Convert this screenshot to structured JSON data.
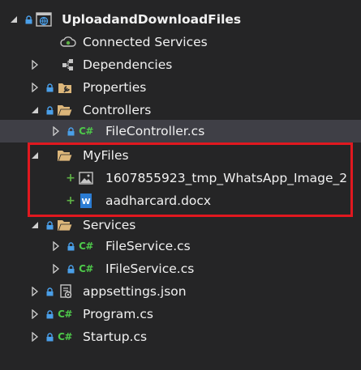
{
  "tree": {
    "project": "UploadandDownloadFiles",
    "connected_services": "Connected Services",
    "dependencies": "Dependencies",
    "properties": "Properties",
    "controllers": "Controllers",
    "file_controller": "FileController.cs",
    "myfiles": "MyFiles",
    "image_file": "1607855923_tmp_WhatsApp_Image_2",
    "docx_file": "aadharcard.docx",
    "services": "Services",
    "file_service": "FileService.cs",
    "ifile_service": "IFileService.cs",
    "appsettings": "appsettings.json",
    "program": "Program.cs",
    "startup": "Startup.cs"
  },
  "icons": {
    "cs_glyph": "C#",
    "word_glyph": "W"
  },
  "colors": {
    "background": "#252526",
    "selected_row": "#3f3f46",
    "folder": "#dcb67a",
    "csharp": "#4ec94a",
    "added": "#5fb346",
    "highlight": "#e1181f",
    "word": "#2b7cd3"
  }
}
